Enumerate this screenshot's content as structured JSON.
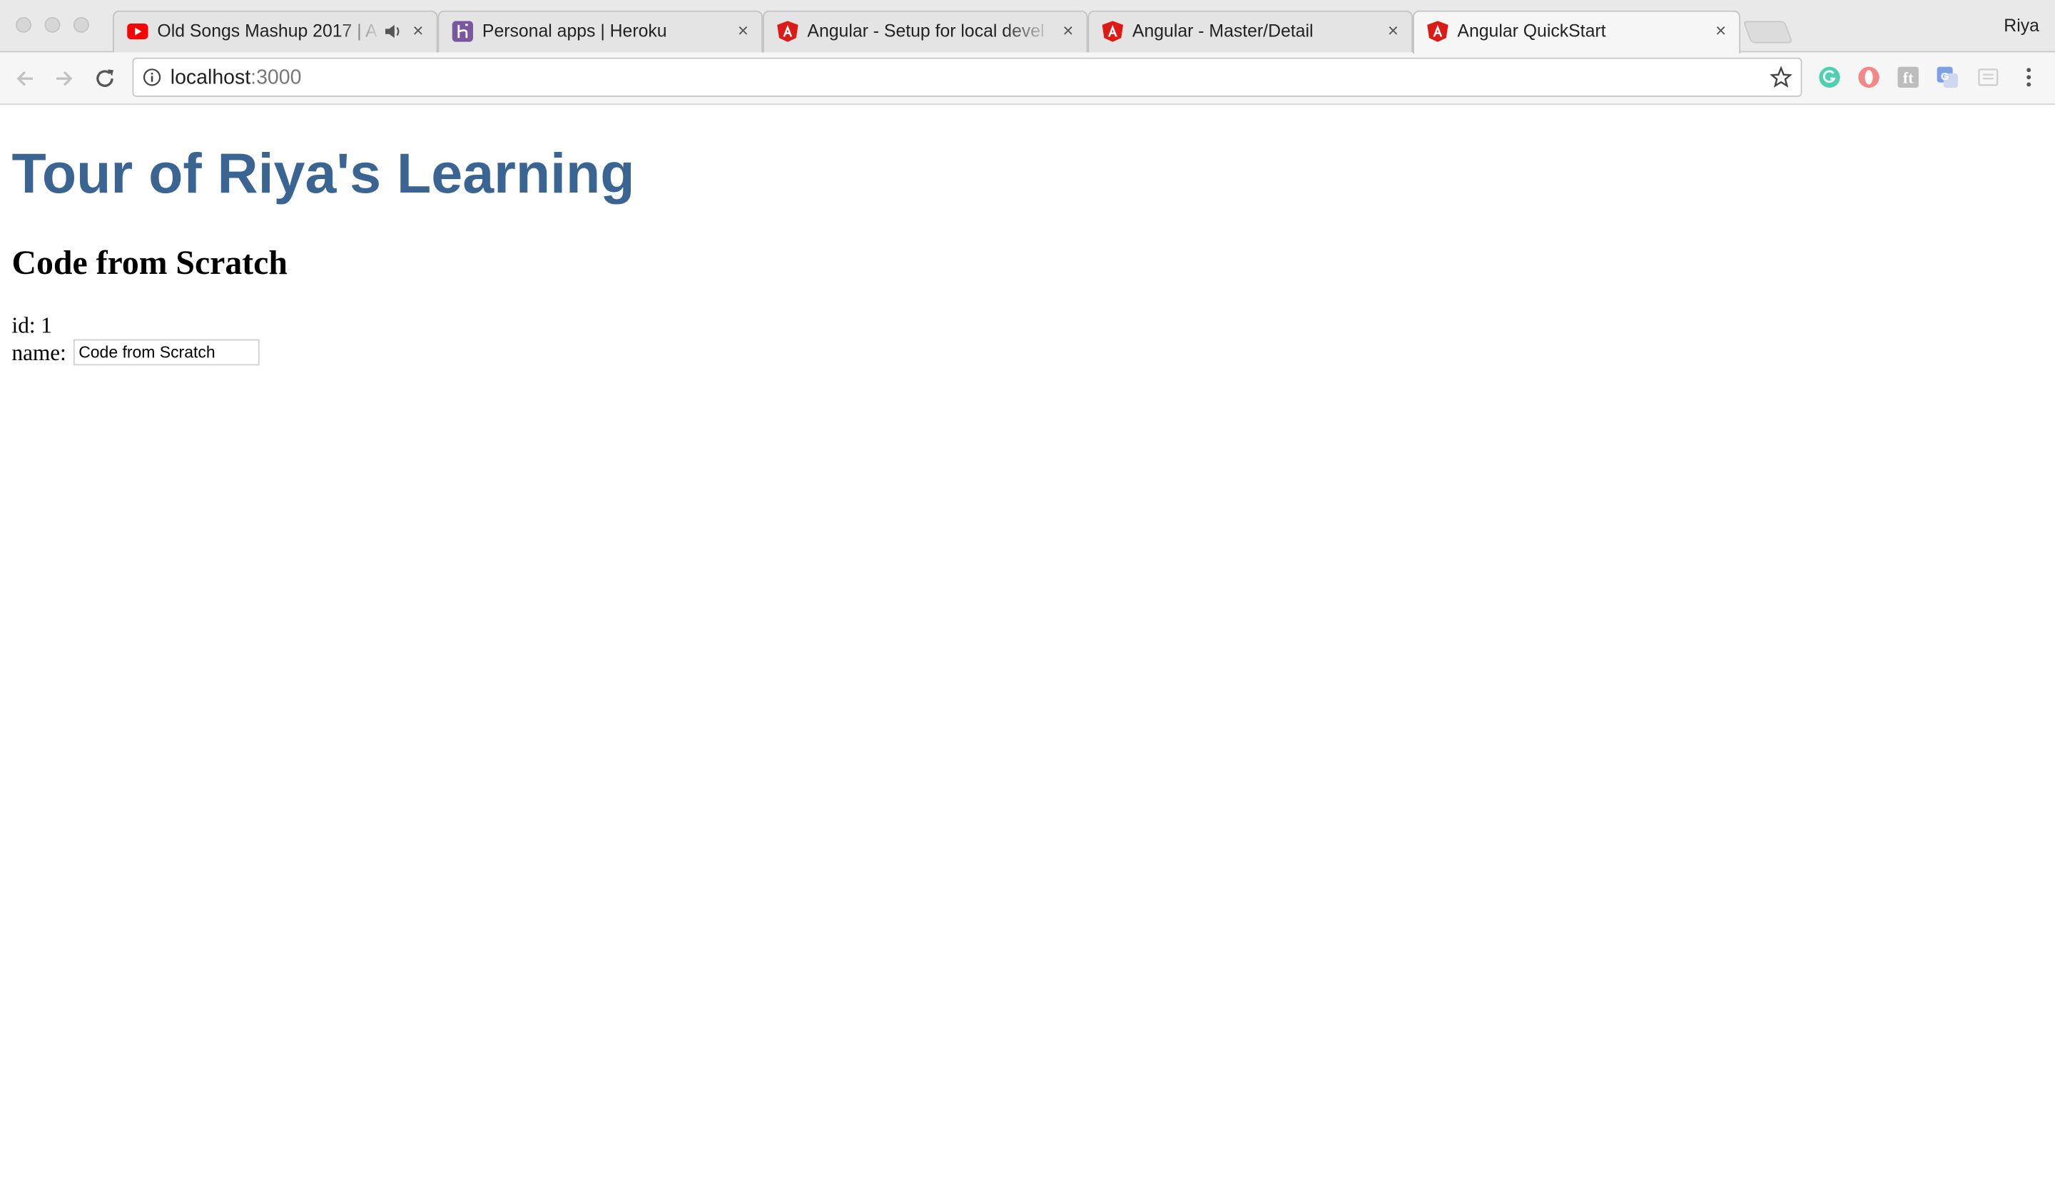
{
  "browser": {
    "tabs": [
      {
        "title": "Old Songs Mashup 2017 | A",
        "favicon": "youtube-icon",
        "audio": true
      },
      {
        "title": "Personal apps | Heroku",
        "favicon": "heroku-icon"
      },
      {
        "title": "Angular - Setup for local devel",
        "favicon": "angular-icon"
      },
      {
        "title": "Angular - Master/Detail",
        "favicon": "angular-icon"
      },
      {
        "title": "Angular QuickStart",
        "favicon": "angular-icon",
        "active": true
      }
    ],
    "profile_name": "Riya",
    "url_host": "localhost",
    "url_port": ":3000",
    "extensions": [
      "grammarly-icon",
      "opera-icon",
      "font-extension-icon",
      "translate-icon",
      "reader-icon"
    ]
  },
  "page": {
    "title": "Tour of Riya's Learning",
    "hero_heading": "Code from Scratch",
    "id_label": "id:",
    "id_value": "1",
    "name_label": "name:",
    "name_value": "Code from Scratch"
  },
  "colors": {
    "title": "#3a6593",
    "youtube": "#ff0000",
    "heroku": "#79589f",
    "angular": "#dd1b16"
  }
}
